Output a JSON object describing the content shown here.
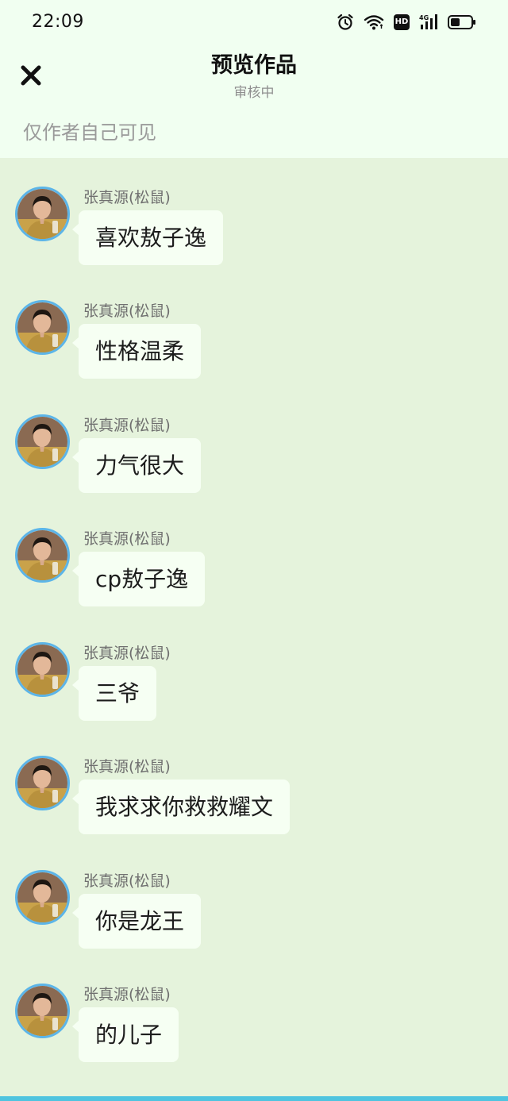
{
  "status_bar": {
    "time": "22:09",
    "icons": [
      "alarm-icon",
      "wifi-icon",
      "hd-icon",
      "signal-4g-icon",
      "battery-icon"
    ],
    "network_label": "4G",
    "hd_label": "HD"
  },
  "header": {
    "close_icon": "close-icon",
    "title": "预览作品",
    "subtitle": "审核中"
  },
  "visibility_note": "仅作者自己可见",
  "colors": {
    "header_bg": "#f1fff1",
    "chat_bg": "#e5f3dc",
    "bubble_bg": "#f6fff3",
    "avatar_border": "#5cb5e8",
    "bottom_strip": "#4fc4df"
  },
  "messages": [
    {
      "sender": "张真源(松鼠)",
      "text": "喜欢敖子逸"
    },
    {
      "sender": "张真源(松鼠)",
      "text": "性格温柔"
    },
    {
      "sender": "张真源(松鼠)",
      "text": "力气很大"
    },
    {
      "sender": "张真源(松鼠)",
      "text": "cp敖子逸"
    },
    {
      "sender": "张真源(松鼠)",
      "text": "三爷"
    },
    {
      "sender": "张真源(松鼠)",
      "text": "我求求你救救耀文"
    },
    {
      "sender": "张真源(松鼠)",
      "text": "你是龙王"
    },
    {
      "sender": "张真源(松鼠)",
      "text": "的儿子"
    }
  ]
}
